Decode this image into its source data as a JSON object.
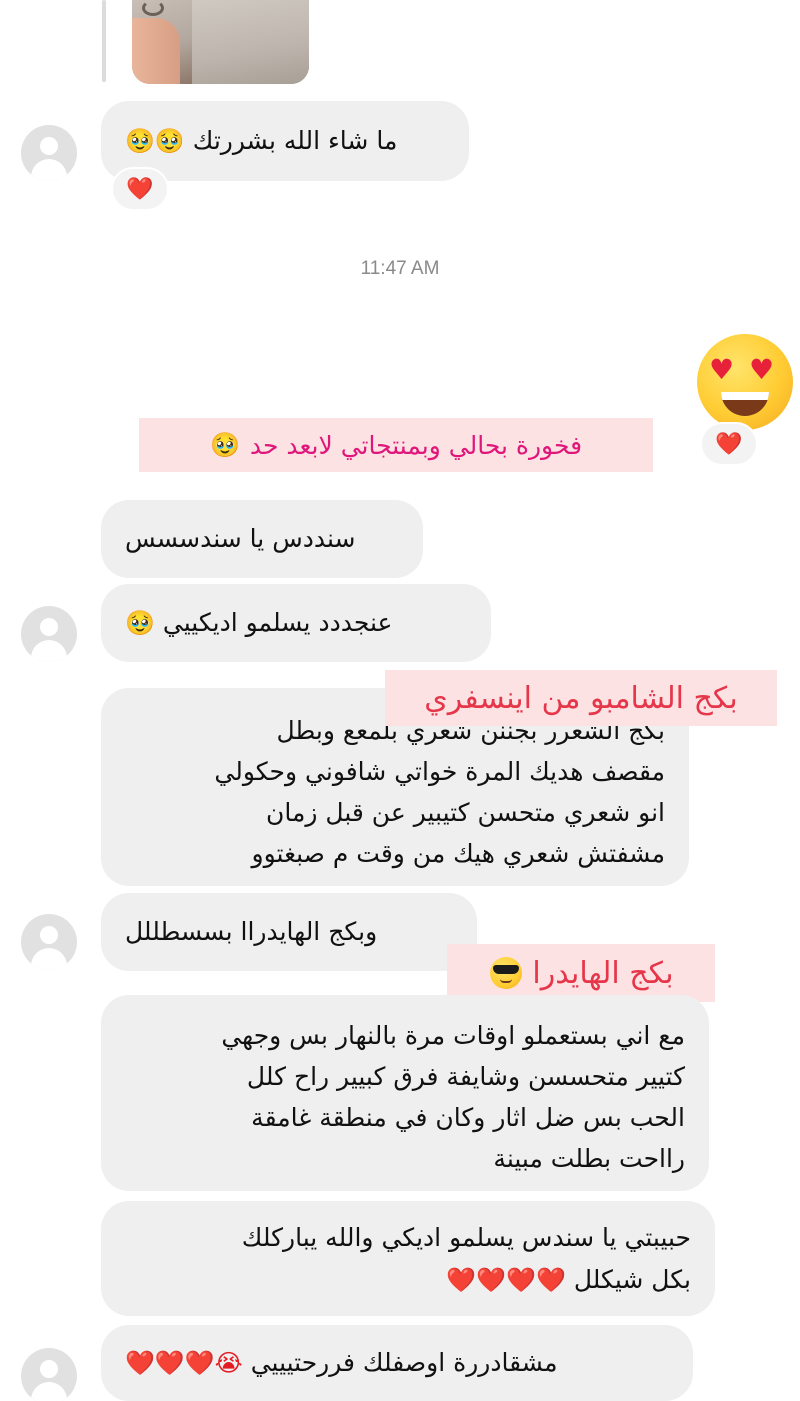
{
  "timestamp": "11:47 AM",
  "emoji": {
    "pleading": "🥹",
    "heart": "❤️",
    "heart_eyes": "😍",
    "sunglasses": "😎",
    "crying": "😭"
  },
  "messages": [
    {
      "id": "m1",
      "text": "ما شاء الله بشررتك",
      "emoji": "🥹🥹",
      "reaction": "❤️"
    },
    {
      "id": "m2",
      "text": "سنددس يا سندسسس"
    },
    {
      "id": "m3",
      "text": "عنجددد يسلمو اديكييي",
      "emoji": "🥹"
    },
    {
      "id": "m4",
      "lines": [
        "بكج الشعرر بجننن شعري بلمعع وبطل",
        "مقصف هديك المرة خواتي شافوني وحكولي",
        "انو شعري متحسن كتيبير عن قبل زمان",
        "مشفتش شعري هيك من وقت م صبغتوو"
      ]
    },
    {
      "id": "m5",
      "text": "وبكج الهايدراا بسسطللل"
    },
    {
      "id": "m6",
      "lines": [
        "مع اني بستعملو اوقات مرة بالنهار بس وجهي",
        "كتيير متحسسن وشايفة فرق كبيير راح كلل",
        "الحب بس ضل اثار وكان في منطقة غامقة",
        "رااحت بطلت مبينة"
      ]
    },
    {
      "id": "m7",
      "lines": [
        "حبيبتي يا سندس يسلمو اديكي والله يباركلك",
        "بكل شيكلل"
      ],
      "emoji": "❤️❤️❤️❤️"
    },
    {
      "id": "m8",
      "text": "مشقادررة اوصفلك فررحتيييي",
      "emoji": "😭❤️❤️❤️"
    }
  ],
  "reply": {
    "reaction": "❤️"
  },
  "stickers": {
    "pride": "فخورة بحالي وبمنتجاتي لابعد حد",
    "shampoo": "بكج الشامبو من اينسفري",
    "hydra": "بكج الهايدرا"
  }
}
